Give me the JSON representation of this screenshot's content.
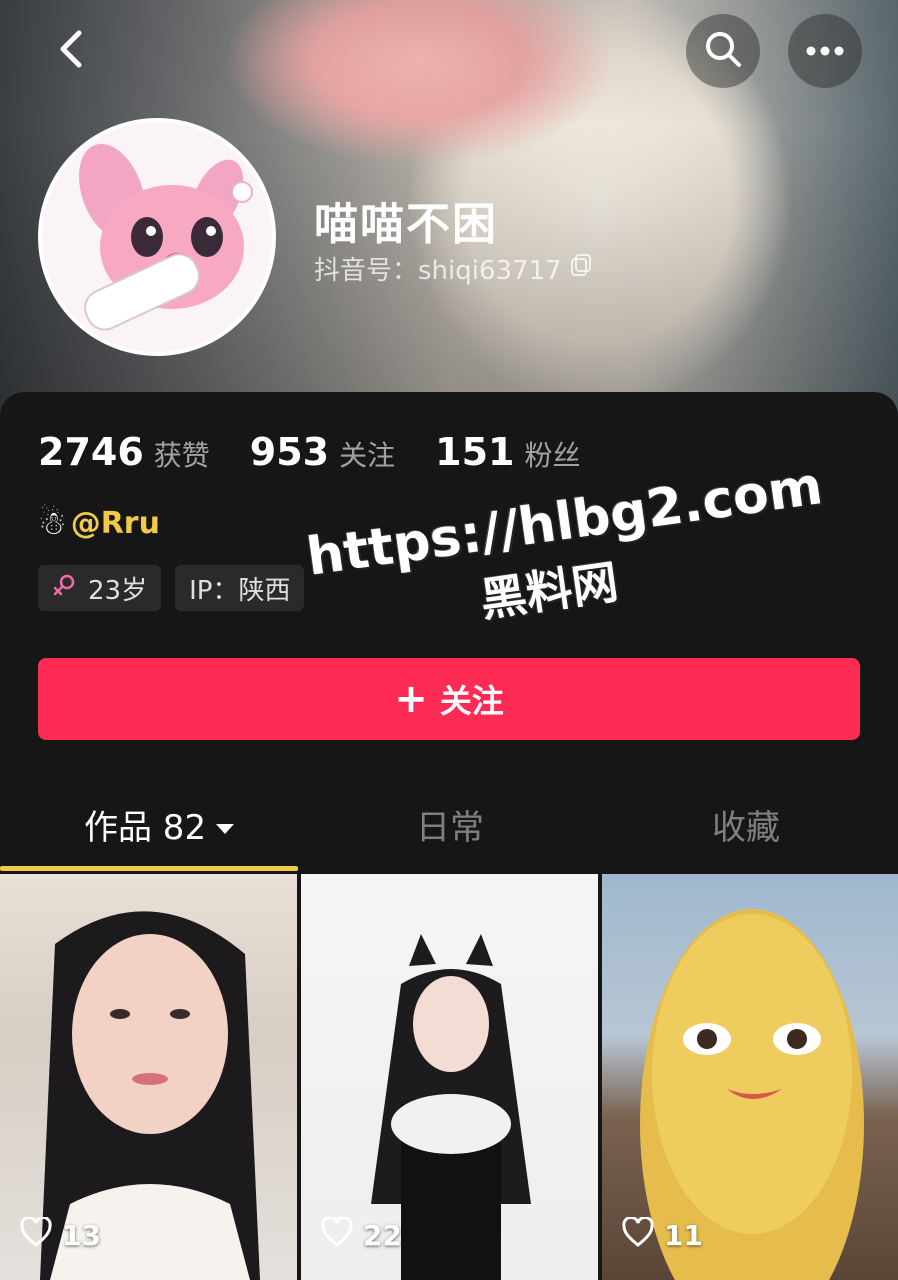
{
  "header": {
    "back_icon": "chevron-left-icon",
    "search_icon": "search-icon",
    "more_icon": "more-horizontal-icon"
  },
  "profile": {
    "name": "喵喵不困",
    "handle_label": "抖音号：shiqi63717",
    "copy_icon": "copy-icon"
  },
  "stats": [
    {
      "value": "2746",
      "label": "获赞"
    },
    {
      "value": "953",
      "label": "关注"
    },
    {
      "value": "151",
      "label": "粉丝"
    }
  ],
  "mention": {
    "emoji": "☃",
    "text": "@Rru"
  },
  "tags": [
    {
      "icon": "female-icon",
      "label": "23岁"
    },
    {
      "label": "IP：陕西"
    }
  ],
  "watermark": {
    "url": "https://hlbg2.com",
    "subtitle": "黑料网"
  },
  "follow_button": {
    "icon": "+",
    "label": "关注",
    "color": "#fe2c55"
  },
  "tabs": [
    {
      "label": "作品 82",
      "active": true
    },
    {
      "label": "日常",
      "active": false
    },
    {
      "label": "收藏",
      "active": false
    }
  ],
  "videos": [
    {
      "likes": "13"
    },
    {
      "likes": "22"
    },
    {
      "likes": "11"
    }
  ],
  "colors": {
    "accent": "#fe2c55",
    "highlight": "#f4c94a",
    "background": "#161616"
  }
}
